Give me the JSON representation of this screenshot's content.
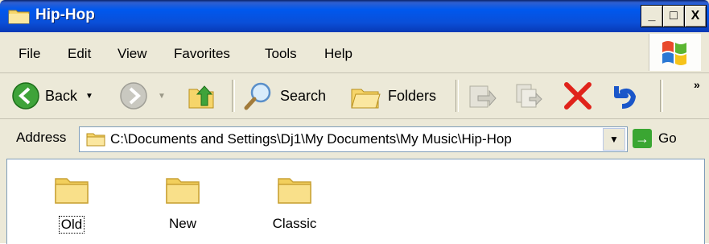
{
  "window": {
    "title": "Hip-Hop",
    "controls": {
      "minimize": "_",
      "maximize": "□",
      "close": "X"
    }
  },
  "menu": [
    "File",
    "Edit",
    "View",
    "Favorites",
    "Tools",
    "Help"
  ],
  "toolbar": {
    "back": "Back",
    "search": "Search",
    "folders": "Folders",
    "overflow": "»"
  },
  "address": {
    "label": "Address",
    "path": "C:\\Documents and Settings\\Dj1\\My Documents\\My Music\\Hip-Hop",
    "go": "Go"
  },
  "folders": [
    {
      "name": "Old",
      "focused": true
    },
    {
      "name": "New",
      "focused": false
    },
    {
      "name": "Classic",
      "focused": false
    }
  ],
  "colors": {
    "titlebar": "#0058ee",
    "chrome": "#ece9d8",
    "folder": "#f6dc7d",
    "delete": "#e0231b",
    "undo": "#1a56c9"
  }
}
